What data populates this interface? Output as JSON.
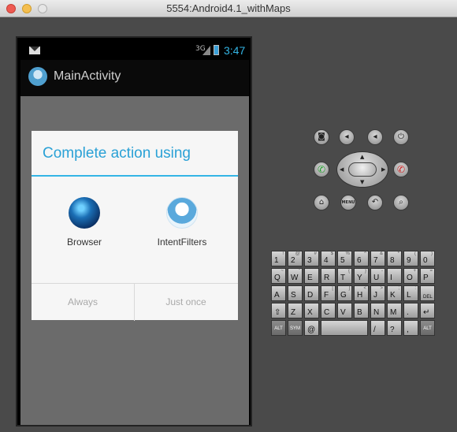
{
  "window": {
    "title": "5554:Android4.1_withMaps"
  },
  "statusbar": {
    "network": "3G",
    "time": "3:47"
  },
  "app": {
    "title": "MainActivity"
  },
  "dialog": {
    "title": "Complete action using",
    "options": [
      {
        "label": "Browser",
        "icon": "browser-globe-icon"
      },
      {
        "label": "IntentFilters",
        "icon": "intentfilters-app-icon"
      }
    ],
    "buttons": {
      "always": "Always",
      "just_once": "Just once"
    }
  },
  "controls": {
    "menu_label": "MENU",
    "icons": [
      "camera-icon",
      "volume-down-icon",
      "volume-up-icon",
      "power-icon",
      "call-icon",
      "end-call-icon",
      "home-icon",
      "menu-icon",
      "back-icon",
      "search-icon"
    ]
  },
  "keyboard": {
    "row1": [
      [
        "1",
        "!"
      ],
      [
        "2",
        "@"
      ],
      [
        "3",
        "#"
      ],
      [
        "4",
        "$"
      ],
      [
        "5",
        "%"
      ],
      [
        "6",
        "^"
      ],
      [
        "7",
        "&"
      ],
      [
        "8",
        "*"
      ],
      [
        "9",
        "("
      ],
      [
        "0",
        ")"
      ]
    ],
    "row2": [
      [
        "Q",
        "~"
      ],
      [
        "W",
        "\""
      ],
      [
        "E",
        ""
      ],
      [
        "R",
        ""
      ],
      [
        "T",
        "{"
      ],
      [
        "Y",
        "}"
      ],
      [
        "U",
        "-"
      ],
      [
        "I",
        ""
      ],
      [
        "O",
        "+"
      ],
      [
        "P",
        "="
      ]
    ],
    "row3": [
      [
        "A",
        ""
      ],
      [
        "S",
        ""
      ],
      [
        "D",
        ""
      ],
      [
        "F",
        "["
      ],
      [
        "G",
        "]"
      ],
      [
        "H",
        "<"
      ],
      [
        "J",
        ">"
      ],
      [
        "K",
        ";"
      ],
      [
        "L",
        ":"
      ],
      [
        "DEL",
        ""
      ]
    ],
    "row4": [
      [
        "⇧",
        ""
      ],
      [
        "Z",
        ""
      ],
      [
        "X",
        ""
      ],
      [
        "C",
        ""
      ],
      [
        "V",
        ""
      ],
      [
        "B",
        ""
      ],
      [
        "N",
        ""
      ],
      [
        "M",
        ""
      ],
      [
        ".",
        ""
      ],
      [
        "↵",
        ""
      ]
    ],
    "row5": {
      "alt": "ALT",
      "sym": "SYM",
      "at": "@",
      "slash": "/",
      "question": "?",
      "comma": ",",
      "alt2": "ALT"
    }
  }
}
